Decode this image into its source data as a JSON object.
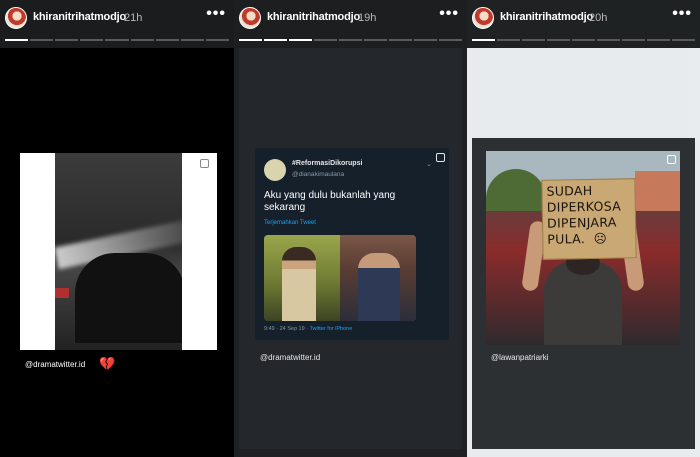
{
  "stories": [
    {
      "username": "khiranitrihatmodjo",
      "time": "21h",
      "more_icon": "more-dots-icon",
      "progress": {
        "segments": 9,
        "active": 1
      },
      "mention": "@dramatwitter.id",
      "emoji": "💔"
    },
    {
      "username": "khiranitrihatmodjo",
      "time": "19h",
      "more_icon": "more-dots-icon",
      "progress": {
        "segments": 9,
        "active": 3
      },
      "mention": "@dramatwitter.id",
      "tweet": {
        "name": "#ReformasiDikorupsi",
        "handle": "@dianakimaulana",
        "text": "Aku yang dulu bukanlah yang sekarang",
        "translate": "Terjemahkan Tweet",
        "meta_time": "9:49 · 24 Sep 19 · ",
        "meta_source": "Twitter for iPhone"
      }
    },
    {
      "username": "khiranitrihatmodjo",
      "time": "20h",
      "more_icon": "more-dots-icon",
      "progress": {
        "segments": 9,
        "active": 1
      },
      "mention": "@lawanpatriarki",
      "sign_text": "SUDAH\nDIPERKOSA\nDIPENJARA\nPULA.  ☹"
    }
  ],
  "colors": {
    "progress_active": "#ffffff",
    "progress_idle": "#5a5a5a",
    "twitter_blue": "#1da1f2",
    "heart": "#d8273c"
  }
}
